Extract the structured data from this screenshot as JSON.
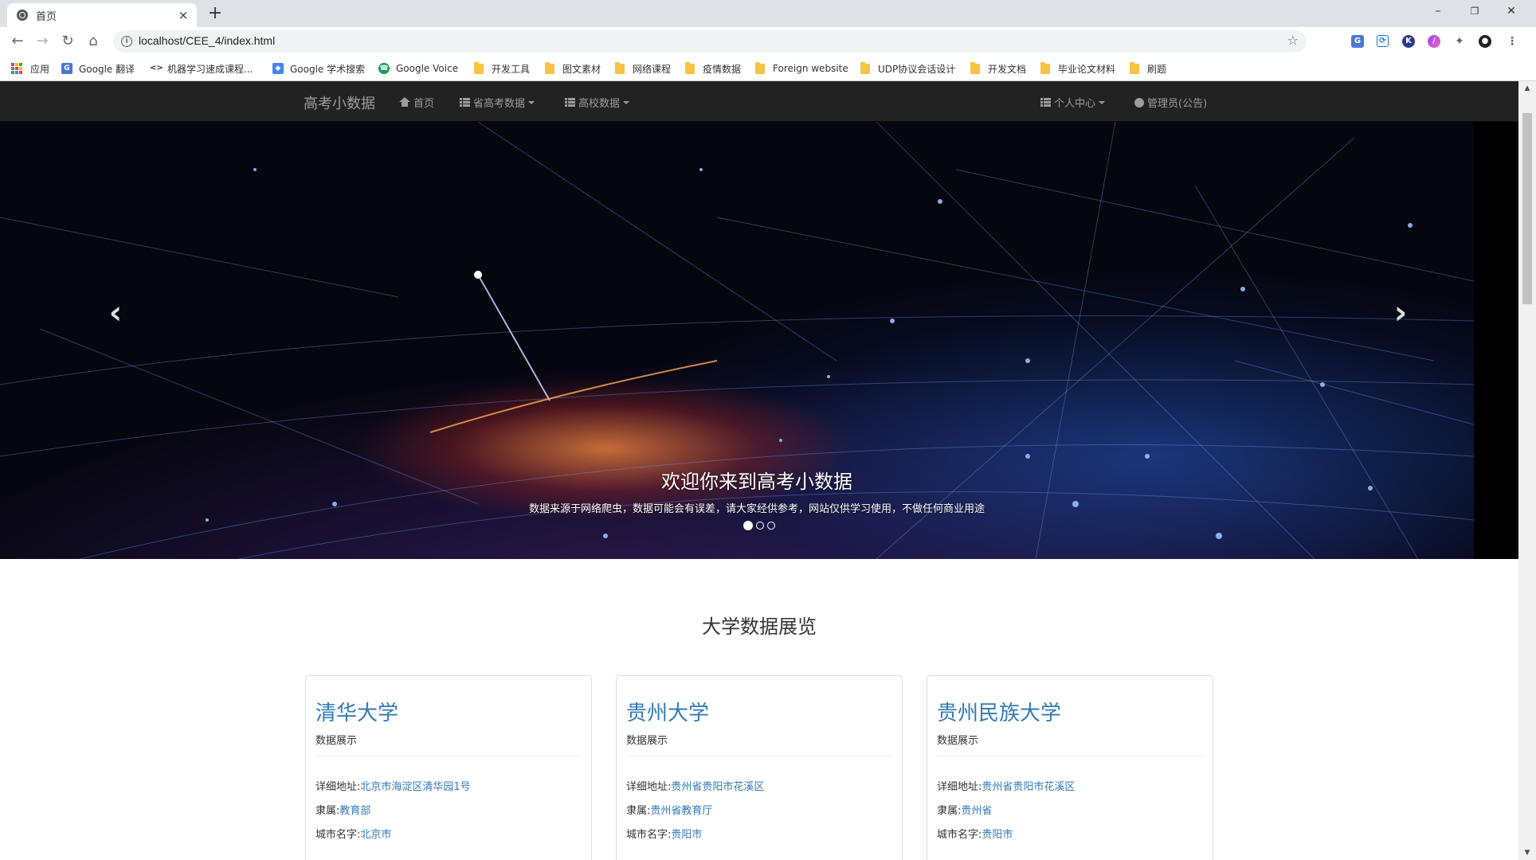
{
  "browser": {
    "tab_title": "首页",
    "tab_close": "×",
    "new_tab": "+",
    "url": "localhost/CEE_4/index.html",
    "window_controls": {
      "minimize": "–",
      "restore": "❐",
      "close": "✕"
    }
  },
  "bookmarks": [
    {
      "label": "应用",
      "icon": "apps-grid-icon"
    },
    {
      "label": "Google 翻译",
      "icon": "google-translate-icon"
    },
    {
      "label": "机器学习速成课程...",
      "icon": "code-icon"
    },
    {
      "label": "Google 学术搜索",
      "icon": "scholar-icon"
    },
    {
      "label": "Google Voice",
      "icon": "voice-icon"
    },
    {
      "label": "开发工具",
      "icon": "folder-icon"
    },
    {
      "label": "图文素材",
      "icon": "folder-icon"
    },
    {
      "label": "网络课程",
      "icon": "folder-icon"
    },
    {
      "label": "疫情数据",
      "icon": "folder-icon"
    },
    {
      "label": "Foreign website",
      "icon": "folder-icon"
    },
    {
      "label": "UDP协议会话设计",
      "icon": "folder-icon"
    },
    {
      "label": "开发文档",
      "icon": "folder-icon"
    },
    {
      "label": "毕业论文材料",
      "icon": "folder-icon"
    },
    {
      "label": "刷题",
      "icon": "folder-icon"
    }
  ],
  "site_nav": {
    "brand": "高考小数据",
    "home": "首页",
    "provincial": "省高考数据",
    "colleges": "高校数据",
    "personal": "个人中心",
    "admin": "管理员(公告)"
  },
  "carousel": {
    "heading": "欢迎你来到高考小数据",
    "subtext": "数据来源于网络爬虫，数据可能会有误差，请大家经供参考，网站仅供学习使用，不做任何商业用途",
    "prev": "‹",
    "next": "›"
  },
  "section_title": "大学数据展览",
  "cards": [
    {
      "name": "清华大学",
      "sub": "数据展示",
      "address_label": "详细地址:",
      "address": "北京市海淀区清华园1号",
      "affil_label": "隶属:",
      "affil": "教育部",
      "city_label": "城市名字:",
      "city": "北京市"
    },
    {
      "name": "贵州大学",
      "sub": "数据展示",
      "address_label": "详细地址:",
      "address": "贵州省贵阳市花溪区",
      "affil_label": "隶属:",
      "affil": "贵州省教育厅",
      "city_label": "城市名字:",
      "city": "贵阳市"
    },
    {
      "name": "贵州民族大学",
      "sub": "数据展示",
      "address_label": "详细地址:",
      "address": "贵州省贵阳市花溪区",
      "affil_label": "隶属:",
      "affil": "贵州省",
      "city_label": "城市名字:",
      "city": "贵阳市"
    }
  ],
  "colors": {
    "link": "#337ab7",
    "navbar": "#222222",
    "navtext": "#9d9d9d"
  }
}
